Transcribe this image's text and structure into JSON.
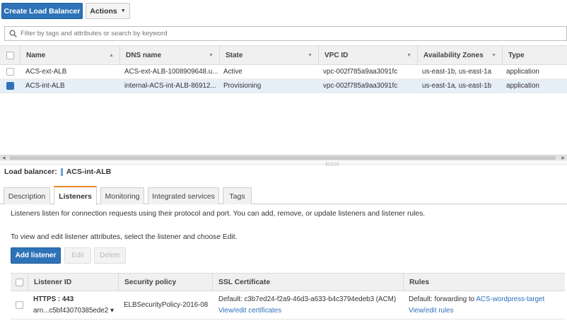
{
  "toolbar": {
    "create_label": "Create Load Balancer",
    "actions_label": "Actions",
    "actions_caret": "▼"
  },
  "search": {
    "placeholder": "Filter by tags and attributes or search by keyword"
  },
  "load_balancers": {
    "columns": [
      {
        "label": "Name",
        "sort": "▲"
      },
      {
        "label": "DNS name",
        "sort": "▼"
      },
      {
        "label": "State",
        "sort": "▼"
      },
      {
        "label": "VPC ID",
        "sort": "▼"
      },
      {
        "label": "Availability Zones",
        "sort": "▼"
      },
      {
        "label": "Type",
        "sort": ""
      }
    ],
    "rows": [
      {
        "name": "ACS-ext-ALB",
        "dns": "ACS-ext-ALB-1008909648.u...",
        "state": "Active",
        "vpc": "vpc-002f785a9aa3091fc",
        "az": "us-east-1b, us-east-1a",
        "type": "application",
        "selected": false
      },
      {
        "name": "ACS-int-ALB",
        "dns": "internal-ACS-int-ALB-86912...",
        "state": "Provisioning",
        "vpc": "vpc-002f785a9aa3091fc",
        "az": "us-east-1a, us-east-1b",
        "type": "application",
        "selected": true
      }
    ]
  },
  "detail": {
    "title_prefix": "Load balancer:",
    "title_value": "ACS-int-ALB",
    "tabs": [
      {
        "label": "Description",
        "active": false
      },
      {
        "label": "Listeners",
        "active": true
      },
      {
        "label": "Monitoring",
        "active": false
      },
      {
        "label": "Integrated services",
        "active": false
      },
      {
        "label": "Tags",
        "active": false
      }
    ],
    "info_text": "Listeners listen for connection requests using their protocol and port. You can add, remove, or update listeners and listener rules.",
    "edit_hint": "To view and edit listener attributes, select the listener and choose Edit.",
    "buttons": {
      "add": "Add listener",
      "edit": "Edit",
      "delete": "Delete"
    }
  },
  "listeners": {
    "columns": [
      "Listener ID",
      "Security policy",
      "SSL Certificate",
      "Rules"
    ],
    "row": {
      "id": "HTTPS : 443",
      "arn": "arn...c5bf43070385ede2",
      "arn_caret": "▾",
      "policy": "ELBSecurityPolicy-2016-08",
      "cert_text": "Default:  c3b7ed24-f2a9-46d3-a633-b4c3794edeb3 (ACM)",
      "cert_link": "View/edit certificates",
      "rules_prefix": "Default:  forwarding to",
      "rules_target": "ACS-wordpress-target",
      "rules_link": "View/edit rules"
    }
  },
  "colors": {
    "primary": "#2e73b8",
    "tab_accent": "#e88b1f",
    "link": "#2f6fba",
    "selected_row": "#e6eef8"
  }
}
